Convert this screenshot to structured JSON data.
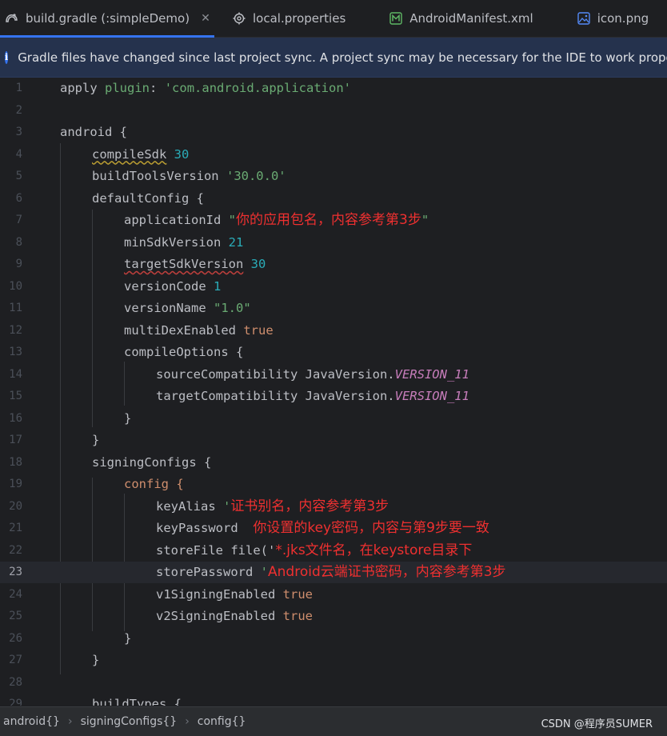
{
  "tabs": [
    {
      "label": "build.gradle (:simpleDemo)",
      "icon": "gradle-icon",
      "active": true,
      "closable": true
    },
    {
      "label": "local.properties",
      "icon": "gear-icon"
    },
    {
      "label": "AndroidManifest.xml",
      "icon": "android-manifest-icon"
    },
    {
      "label": "icon.png",
      "icon": "image-icon"
    }
  ],
  "close_glyph": "✕",
  "banner": {
    "text": "Gradle files have changed since last project sync. A project sync may be necessary for the IDE to work properly."
  },
  "lines": [
    {
      "n": "1",
      "t": "apply plugin: 'com.android.application'"
    },
    {
      "n": "2",
      "t": ""
    },
    {
      "n": "3",
      "t": "android {"
    },
    {
      "n": "4",
      "t": "    compileSdk 30"
    },
    {
      "n": "5",
      "t": "    buildToolsVersion '30.0.0'"
    },
    {
      "n": "6",
      "t": "    defaultConfig {"
    },
    {
      "n": "7",
      "t": "        applicationId \"你的应用包名，内容参考第3步\""
    },
    {
      "n": "8",
      "t": "        minSdkVersion 21"
    },
    {
      "n": "9",
      "t": "        targetSdkVersion 30"
    },
    {
      "n": "10",
      "t": "        versionCode 1"
    },
    {
      "n": "11",
      "t": "        versionName \"1.0\""
    },
    {
      "n": "12",
      "t": "        multiDexEnabled true"
    },
    {
      "n": "13",
      "t": "        compileOptions {"
    },
    {
      "n": "14",
      "t": "            sourceCompatibility JavaVersion.VERSION_11"
    },
    {
      "n": "15",
      "t": "            targetCompatibility JavaVersion.VERSION_11"
    },
    {
      "n": "16",
      "t": "        }"
    },
    {
      "n": "17",
      "t": "    }"
    },
    {
      "n": "18",
      "t": "    signingConfigs {"
    },
    {
      "n": "19",
      "t": "        config {"
    },
    {
      "n": "20",
      "t": "            keyAlias '证书别名，内容参考第3步"
    },
    {
      "n": "21",
      "t": "            keyPassword 你设置的key密码，内容与第9步要一致"
    },
    {
      "n": "22",
      "t": "            storeFile file('*.jks文件名，在keystore目录下"
    },
    {
      "n": "23",
      "t": "            storePassword 'Android云端证书密码，内容参考第3步"
    },
    {
      "n": "24",
      "t": "            v1SigningEnabled true"
    },
    {
      "n": "25",
      "t": "            v2SigningEnabled true"
    },
    {
      "n": "26",
      "t": "        }"
    },
    {
      "n": "27",
      "t": "    }"
    },
    {
      "n": "28",
      "t": ""
    },
    {
      "n": "29",
      "t": "    buildTypes {"
    }
  ],
  "code": {
    "l1": {
      "kw": "apply",
      "plugin": "plugin",
      "colon": ":",
      "str": "'com.android.application'"
    },
    "l3": {
      "a": "android {"
    },
    "l4": {
      "name": "compileSdk",
      "num": "30"
    },
    "l5": {
      "name": "buildToolsVersion",
      "str": "'30.0.0'"
    },
    "l6": {
      "a": "defaultConfig {"
    },
    "l7": {
      "name": "applicationId",
      "q1": "\"",
      "anno": "你的应用包名，内容参考第3步",
      "q2": "\""
    },
    "l8": {
      "name": "minSdkVersion",
      "num": "21"
    },
    "l9": {
      "name": "targetSdkVersion",
      "num": "30"
    },
    "l10": {
      "name": "versionCode",
      "num": "1"
    },
    "l11": {
      "name": "versionName",
      "str": "\"1.0\""
    },
    "l12": {
      "name": "multiDexEnabled",
      "kw": "true"
    },
    "l13": {
      "a": "compileOptions {"
    },
    "l14": {
      "name": "sourceCompatibility",
      "cls": "JavaVersion.",
      "fld": "VERSION_11"
    },
    "l15": {
      "name": "targetCompatibility",
      "cls": "JavaVersion.",
      "fld": "VERSION_11"
    },
    "l16": {
      "a": "}"
    },
    "l17": {
      "a": "}"
    },
    "l18": {
      "a": "signingConfigs {"
    },
    "l19": {
      "a": "config {"
    },
    "l20": {
      "name": "keyAlias",
      "q": "'",
      "anno": "证书别名，内容参考第3步"
    },
    "l21": {
      "name": "keyPassword",
      "anno": "你设置的key密码，内容与第9步要一致"
    },
    "l22": {
      "name": "storeFile",
      "fn": "file('",
      "anno": "*.jks文件名，在keystore目录下"
    },
    "l23": {
      "name": "storePassword",
      "q": "'",
      "anno": "Android云端证书密码，内容参考第3步"
    },
    "l24": {
      "name": "v1SigningEnabled",
      "kw": "true"
    },
    "l25": {
      "name": "v2SigningEnabled",
      "kw": "true"
    },
    "l26": {
      "a": "}"
    },
    "l27": {
      "a": "}"
    },
    "l29": {
      "a": "buildTypes {"
    }
  },
  "current_line": "23",
  "breadcrumbs": [
    "android{}",
    "signingConfigs{}",
    "config{}"
  ],
  "watermark": "CSDN @程序员SUMER",
  "colors": {
    "accent": "#3574f0",
    "keyword": "#cf8e6d",
    "string": "#6aab73",
    "number": "#2aacb8",
    "annotation": "#ef3030"
  }
}
